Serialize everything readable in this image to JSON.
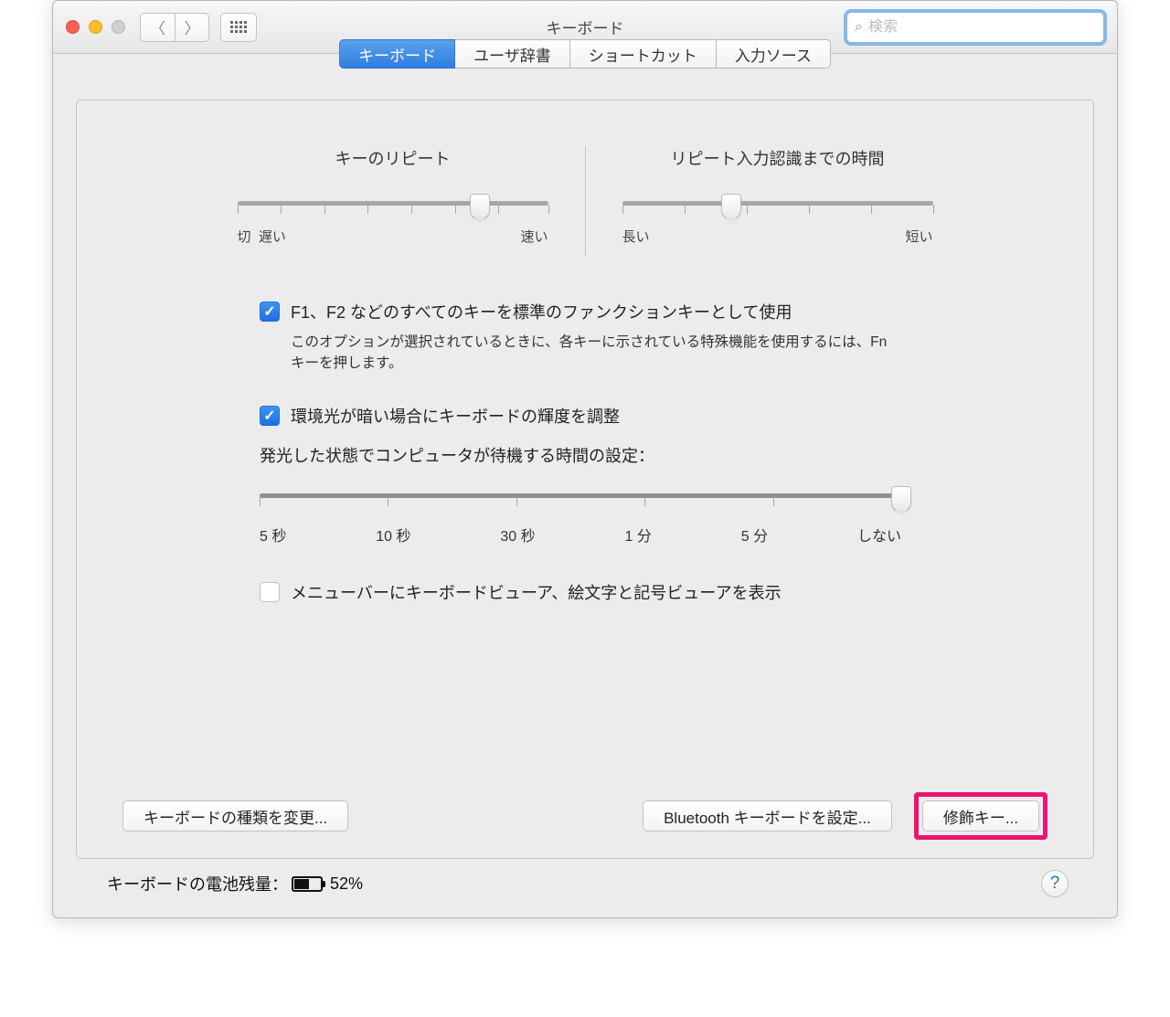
{
  "window": {
    "title": "キーボード"
  },
  "search": {
    "placeholder": "検索"
  },
  "tabs": [
    "キーボード",
    "ユーザ辞書",
    "ショートカット",
    "入力ソース"
  ],
  "sliders": {
    "repeat": {
      "label": "キーのリピート",
      "left": "切",
      "left2": "遅い",
      "right": "速い",
      "thumb_pct": 78
    },
    "delay": {
      "label": "リピート入力認識までの時間",
      "left": "長い",
      "right": "短い",
      "thumb_pct": 35
    }
  },
  "fn_check": {
    "label": "F1、F2 などのすべてのキーを標準のファンクションキーとして使用",
    "sub": "このオプションが選択されているときに、各キーに示されている特殊機能を使用するには、Fn キーを押します。",
    "checked": true
  },
  "ambient_check": {
    "label": "環境光が暗い場合にキーボードの輝度を調整",
    "checked": true
  },
  "backlight": {
    "label": "発光した状態でコンピュータが待機する時間の設定：",
    "ticks": [
      "5 秒",
      "10 秒",
      "30 秒",
      "1 分",
      "5 分",
      "しない"
    ],
    "thumb_pct": 100
  },
  "menubar_check": {
    "label": "メニューバーにキーボードビューア、絵文字と記号ビューアを表示",
    "checked": false
  },
  "buttons": {
    "change_type": "キーボードの種類を変更...",
    "bluetooth": "Bluetooth キーボードを設定...",
    "modifier": "修飾キー..."
  },
  "battery": {
    "label": "キーボードの電池残量：",
    "value": "52%"
  },
  "help": "?"
}
